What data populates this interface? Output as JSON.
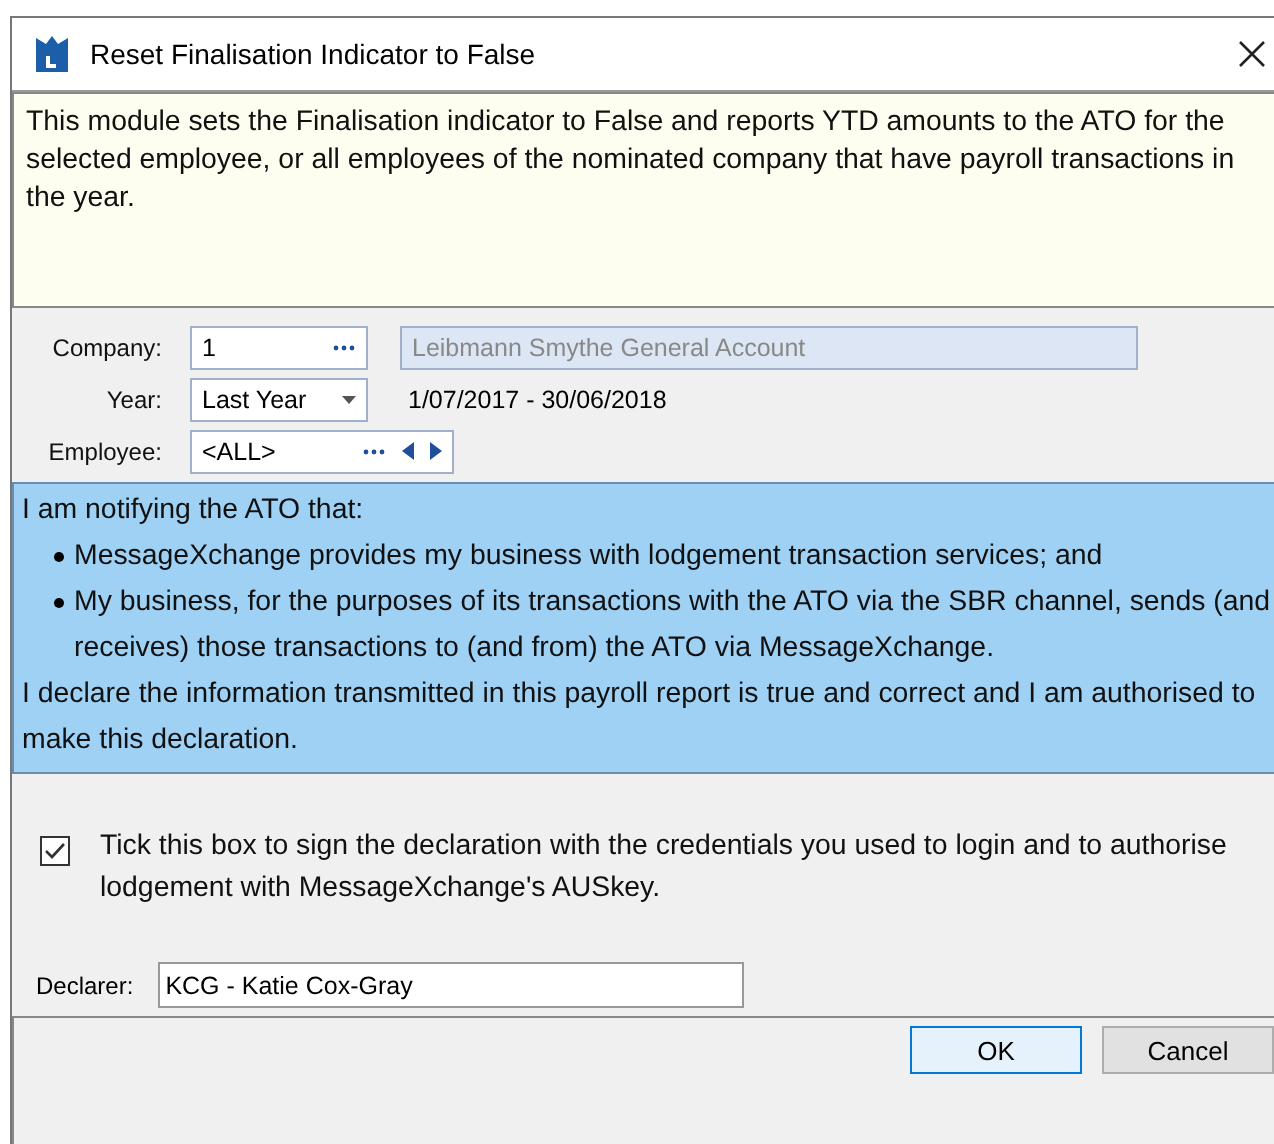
{
  "window": {
    "title": "Reset Finalisation Indicator to False"
  },
  "info": "This module sets the Finalisation indicator to False and reports YTD amounts to the ATO for the selected employee, or all employees of the nominated company that have payroll transactions in the year.",
  "company": {
    "label": "Company:",
    "value": "1",
    "name": "Leibmann Smythe General Account"
  },
  "year": {
    "label": "Year:",
    "value": "Last Year",
    "range": "1/07/2017 - 30/06/2018"
  },
  "employee": {
    "label": "Employee:",
    "value": "<ALL>"
  },
  "declaration": {
    "intro": "I am notifying the ATO that:",
    "bullets": [
      "MessageXchange provides my business with lodgement transaction services; and",
      "My business, for the purposes of its transactions with the ATO via the SBR channel, sends (and receives) those transactions to (and from) the ATO via MessageXchange."
    ],
    "closing": "I declare the information transmitted in this payroll report is true and correct and I am authorised to make this declaration."
  },
  "sign": {
    "label": "Tick this box to sign the declaration with the credentials you used to login and to authorise lodgement with MessageXchange's AUSkey.",
    "checked": true
  },
  "declarer": {
    "label": "Declarer:",
    "value": "KCG - Katie Cox-Gray"
  },
  "buttons": [
    {
      "label": "OK",
      "default": true
    },
    {
      "label": "Cancel",
      "default": false
    }
  ]
}
